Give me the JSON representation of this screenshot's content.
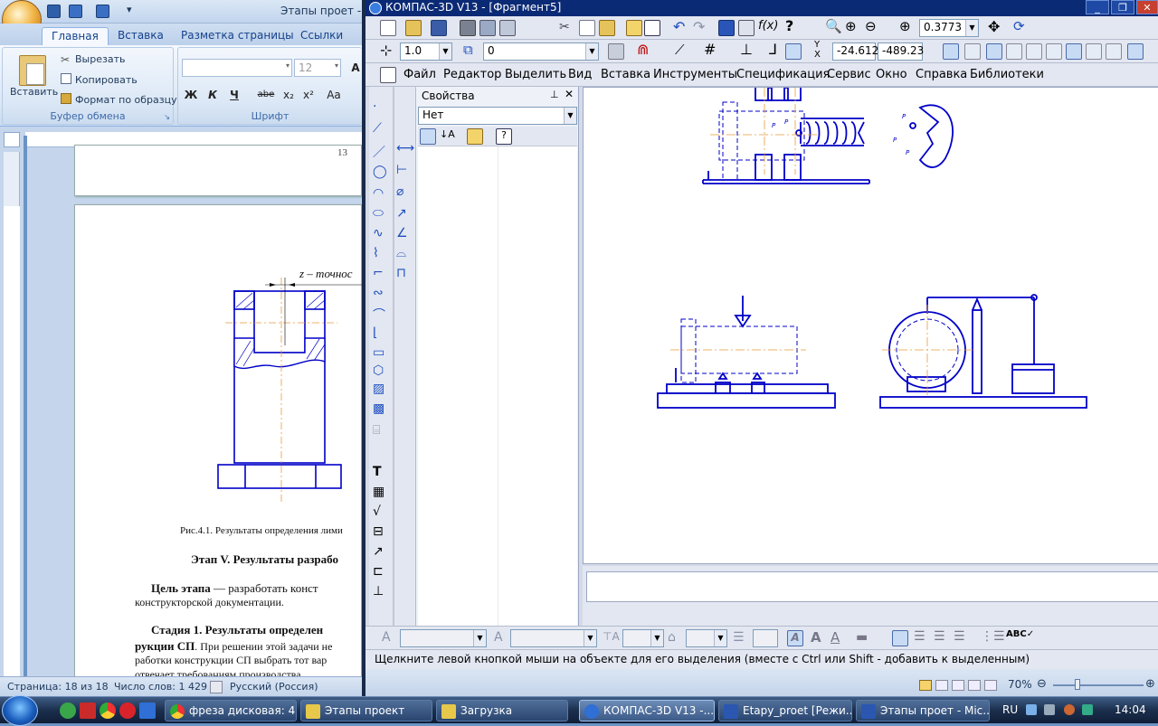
{
  "word": {
    "title": "Этапы проет -",
    "tabs": [
      "Главная",
      "Вставка",
      "Разметка страницы",
      "Ссылки"
    ],
    "clipboard": {
      "paste": "Вставить",
      "cut": "Вырезать",
      "copy": "Копировать",
      "format_painter": "Формат по образцу",
      "group_label": "Буфер обмена"
    },
    "font": {
      "size": "12",
      "group_label": "Шрифт",
      "buttons": [
        "Ж",
        "К",
        "Ч",
        "abe",
        "x₂",
        "x²",
        "Aa"
      ]
    },
    "document": {
      "page_number": "13",
      "dimension_label": "z – точнос",
      "figure_caption": "Рис.4.1. Результаты определения лими",
      "heading": "Этап V. Результаты разрабо",
      "paragraph1_bold": "Цель этапа",
      "paragraph1_rest": " — разработать конст",
      "paragraph1_line2": "конструкторской документации.",
      "paragraph2_bold": "Стадия 1. Результаты определен",
      "paragraph2_line2_bold": "рукции СП",
      "paragraph2_line2_rest": ". При решении этой задачи не",
      "paragraph2_line3": "работки конструкции СП выбрать тот вар",
      "paragraph2_line4": "отвечает требованиям производства"
    },
    "status": {
      "page": "Страница: 18 из 18",
      "words": "Число слов: 1 429",
      "language": "Русский (Россия)"
    }
  },
  "kompas": {
    "title": "КОМПАС-3D V13 - [Фрагмент5]",
    "zoom_value": "0.3773",
    "line_scale": "1.0",
    "layer": "0",
    "coord_x": "-24.612",
    "coord_y": "-489.23",
    "menu": [
      "Файл",
      "Редактор",
      "Выделить",
      "Вид",
      "Вставка",
      "Инструменты",
      "Спецификация",
      "Сервис",
      "Окно",
      "Справка",
      "Библиотеки"
    ],
    "properties": {
      "title": "Свойства",
      "selector": "Нет"
    },
    "status_text": "Щелкните левой кнопкой мыши на объекте для его выделения (вместе с Ctrl или Shift - добавить к выделенным)",
    "zoom_percent": "70%"
  },
  "taskbar": {
    "items": [
      {
        "label": "фреза дисковая: 4...",
        "color": "#e8a22b"
      },
      {
        "label": "Этапы проект",
        "color": "#e8c84a"
      },
      {
        "label": "Загрузка",
        "color": "#e8c84a"
      },
      {
        "label": "КОМПАС-3D V13 -...",
        "color": "#2f6fd6"
      },
      {
        "label": "Etapy_proet [Режи...",
        "color": "#2b57b0"
      },
      {
        "label": "Этапы проет - Mic...",
        "color": "#2b57b0"
      }
    ],
    "language": "RU",
    "time": "14:04"
  }
}
